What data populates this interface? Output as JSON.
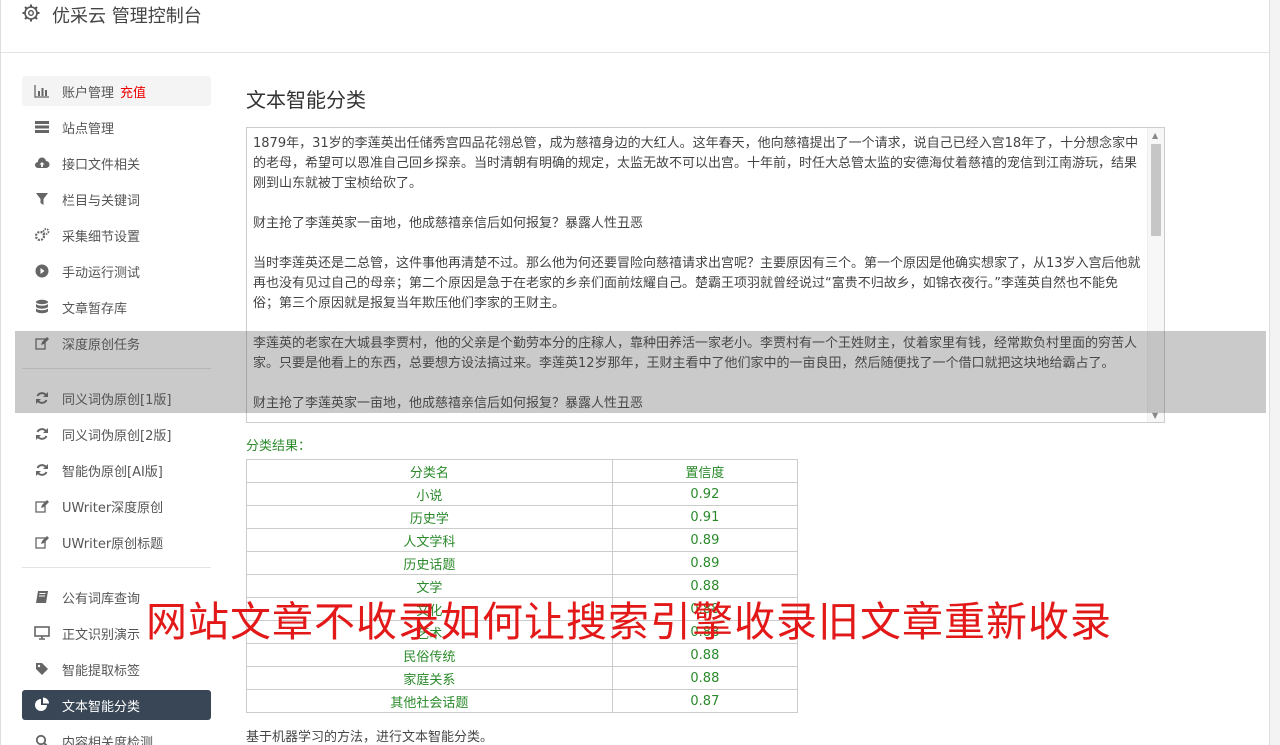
{
  "app": {
    "title": "优采云 管理控制台"
  },
  "sidebar": {
    "items": [
      {
        "label": "账户管理",
        "badge": "充值",
        "icon": "bar-chart-icon"
      },
      {
        "label": "站点管理",
        "icon": "server-icon"
      },
      {
        "label": "接口文件相关",
        "icon": "cloud-upload-icon"
      },
      {
        "label": "栏目与关键词",
        "icon": "filter-icon"
      },
      {
        "label": "采集细节设置",
        "icon": "gears-icon"
      },
      {
        "label": "手动运行测试",
        "icon": "play-icon"
      },
      {
        "label": "文章暂存库",
        "icon": "database-icon"
      },
      {
        "label": "深度原创任务",
        "icon": "edit-icon"
      },
      {
        "label": "同义词伪原创[1版]",
        "icon": "refresh-icon"
      },
      {
        "label": "同义词伪原创[2版]",
        "icon": "refresh-icon"
      },
      {
        "label": "智能伪原创[AI版]",
        "icon": "refresh-icon"
      },
      {
        "label": "UWriter深度原创",
        "icon": "edit-icon"
      },
      {
        "label": "UWriter原创标题",
        "icon": "edit-icon"
      },
      {
        "label": "公有词库查询",
        "icon": "book-icon"
      },
      {
        "label": "正文识别演示",
        "icon": "monitor-icon"
      },
      {
        "label": "智能提取标签",
        "icon": "tag-icon"
      },
      {
        "label": "文本智能分类",
        "icon": "pie-chart-icon"
      },
      {
        "label": "内容相关度检测",
        "icon": "search-icon"
      }
    ]
  },
  "main": {
    "title": "文本智能分类",
    "text_paragraphs": [
      "1879年，31岁的李莲英出任储秀宫四品花翎总管，成为慈禧身边的大红人。这年春天，他向慈禧提出了一个请求，说自己已经入宫18年了，十分想念家中的老母，希望可以恩准自己回乡探亲。当时清朝有明确的规定，太监无故不可以出宫。十年前，时任大总管太监的安德海仗着慈禧的宠信到江南游玩，结果刚到山东就被丁宝桢给砍了。",
      "财主抢了李莲英家一亩地，他成慈禧亲信后如何报复？暴露人性丑恶",
      "当时李莲英还是二总管，这件事他再清楚不过。那么他为何还要冒险向慈禧请求出宫呢？主要原因有三个。第一个原因是他确实想家了，从13岁入宫后他就再也没有见过自己的母亲；第二个原因是急于在老家的乡亲们面前炫耀自己。楚霸王项羽就曾经说过“富贵不归故乡，如锦衣夜行。”李莲英自然也不能免俗；第三个原因就是报复当年欺压他们李家的王财主。",
      "李莲英的老家在大城县李贾村，他的父亲是个勤劳本分的庄稼人，靠种田养活一家老小。李贾村有一个王姓财主，仗着家里有钱，经常欺负村里面的穷苦人家。只要是他看上的东西，总要想方设法搞过来。李莲英12岁那年，王财主看中了他们家中的一亩良田，然后随便找了一个借口就把这块地给霸占了。",
      "财主抢了李莲英家一亩地，他成慈禧亲信后如何报复？暴露人性丑恶"
    ],
    "result_label": "分类结果：",
    "table_headers": [
      "分类名",
      "置信度"
    ],
    "rows": [
      [
        "小说",
        "0.92"
      ],
      [
        "历史学",
        "0.91"
      ],
      [
        "人文学科",
        "0.89"
      ],
      [
        "历史话题",
        "0.89"
      ],
      [
        "文学",
        "0.88"
      ],
      [
        "文化",
        "0.88"
      ],
      [
        "艺术",
        "0.88"
      ],
      [
        "民俗传统",
        "0.88"
      ],
      [
        "家庭关系",
        "0.88"
      ],
      [
        "其他社会话题",
        "0.87"
      ]
    ],
    "footer_note": "基于机器学习的方法，进行文本智能分类。"
  },
  "watermark": "网站文章不收录如何让搜索引擎收录旧文章重新收录"
}
